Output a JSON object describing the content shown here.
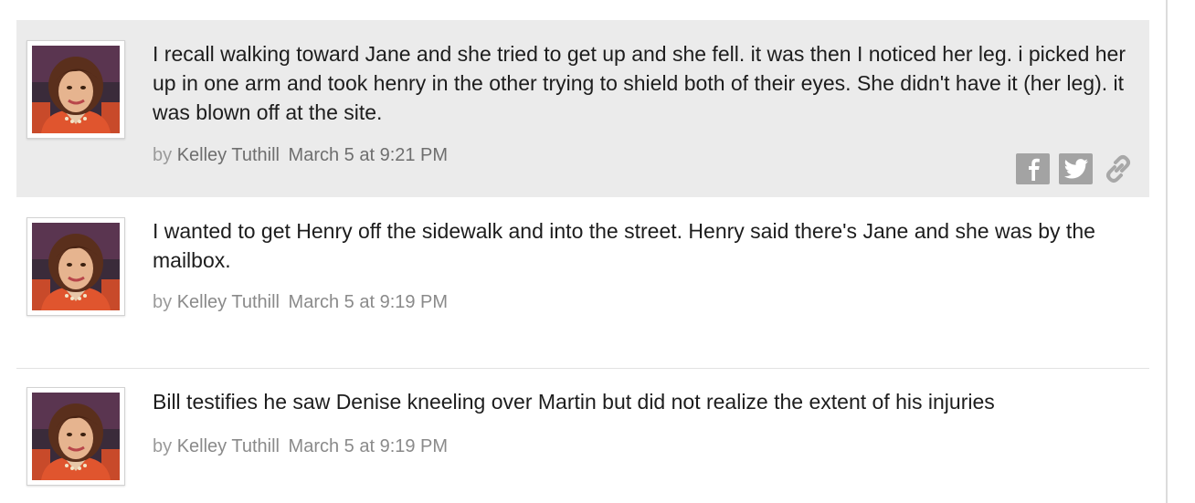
{
  "posts": [
    {
      "text": "I recall walking toward Jane and she tried to get up and she fell. it was then I noticed her leg. i picked her up in one arm and took henry in the other trying to shield both of their eyes. She didn't have it (her leg). it was blown off at the site.",
      "by_prefix": "by",
      "author": "Kelley Tuthill",
      "timestamp": "March 5 at 9:21 PM",
      "highlighted": true,
      "share_icons": [
        "facebook-icon",
        "twitter-icon",
        "link-icon"
      ]
    },
    {
      "text": "I wanted to get Henry off the sidewalk and into the street. Henry said there's Jane and she was by the mailbox.",
      "by_prefix": "by",
      "author": "Kelley Tuthill",
      "timestamp": "March 5 at 9:19 PM",
      "highlighted": false
    },
    {
      "text": "Bill testifies he saw Denise kneeling over Martin but did not realize the extent of his injuries",
      "by_prefix": "by",
      "author": "Kelley Tuthill",
      "timestamp": "March 5 at 9:19 PM",
      "highlighted": false
    }
  ],
  "colors": {
    "highlight_bg": "#ebebeb",
    "share_icon_bg": "#a3a3a3",
    "body_text": "#1d1d1d",
    "byline_text": "#9a9a9a"
  }
}
